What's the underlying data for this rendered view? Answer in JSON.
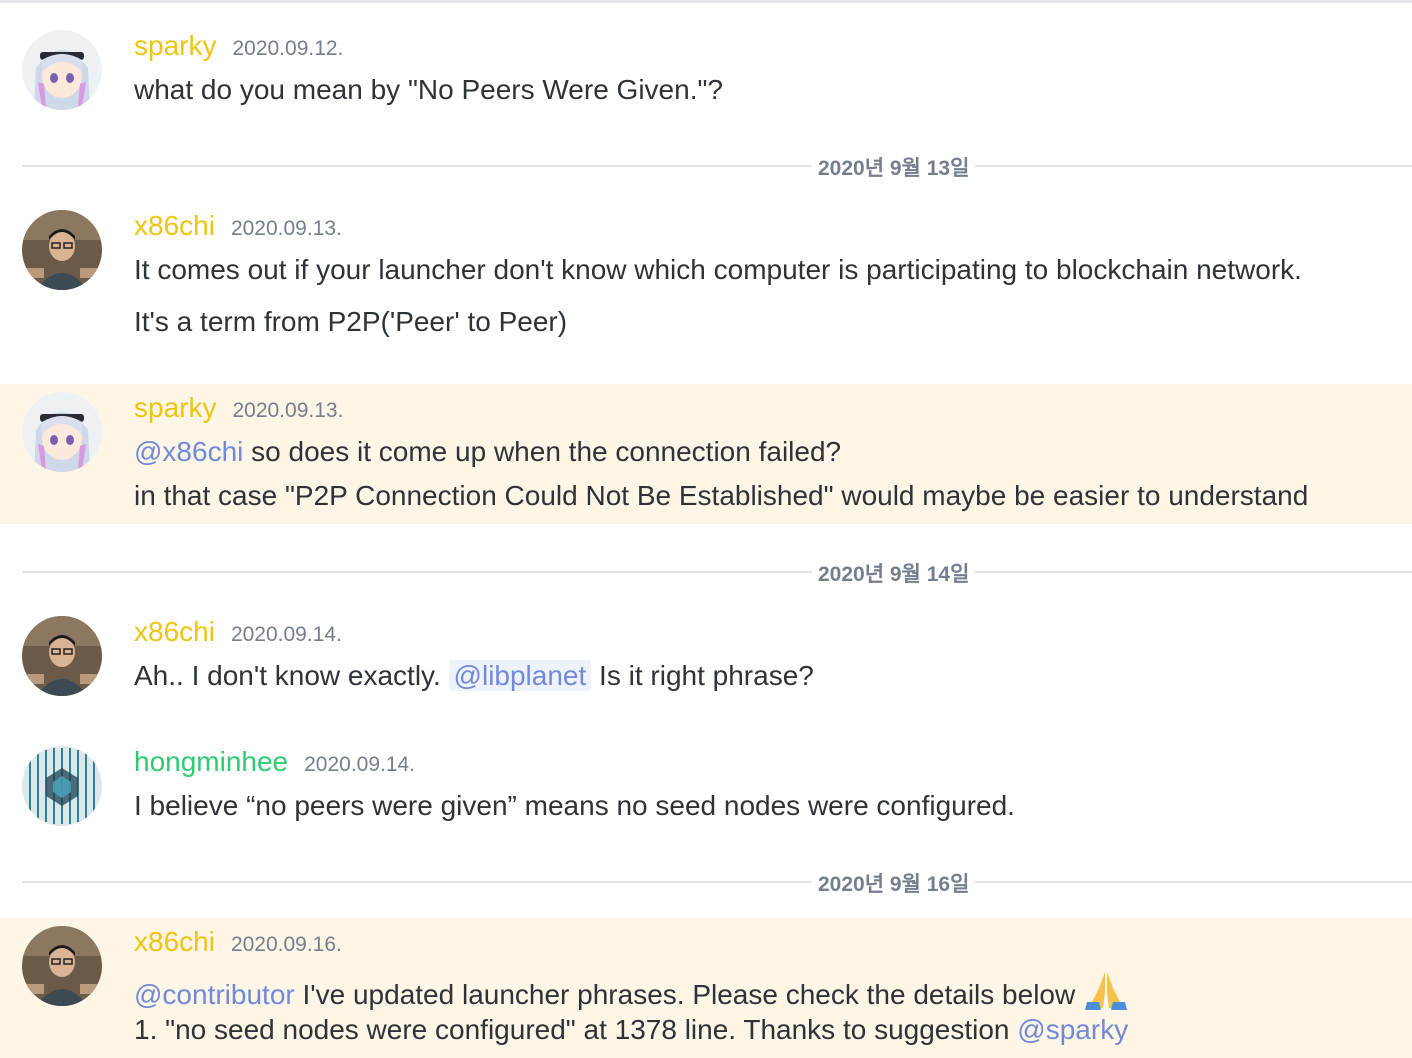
{
  "colors": {
    "username_yellow": "#f1c40f",
    "username_green": "#2ecc71",
    "mention_highlight": "#fdf5e6",
    "ping_blue": "#7289da",
    "timestamp_gray": "#747f8d"
  },
  "messages": [
    {
      "username": "sparky",
      "timestamp": "2020.09.12.",
      "lines": [
        "what do you mean by \"No Peers Were Given.\"?"
      ]
    },
    {
      "username": "x86chi",
      "timestamp": "2020.09.13.",
      "lines": [
        "It comes out if your launcher don't know which computer is participating to blockchain network.",
        "It's a term from P2P('Peer' to Peer)"
      ]
    },
    {
      "username": "sparky",
      "timestamp": "2020.09.13.",
      "mention": "@x86chi",
      "line1_rest": " so does it come up when the connection failed?",
      "line2": "in that case \"P2P Connection Could Not Be Established\" would maybe be easier to understand"
    },
    {
      "username": "x86chi",
      "timestamp": "2020.09.14.",
      "line_before": "Ah.. I don't know exactly. ",
      "role_mention": "@libplanet",
      "line_after": " Is it right phrase?"
    },
    {
      "username": "hongminhee",
      "timestamp": "2020.09.14.",
      "lines": [
        "I believe “no peers were given” means no seed nodes were configured."
      ]
    },
    {
      "username": "x86chi",
      "timestamp": "2020.09.16.",
      "mention": "@contributor",
      "line1_rest": " I've updated launcher phrases. Please check the details below ",
      "emoji": "folded-hands-emoji",
      "line2_text": "1. \"no seed nodes were configured\" at 1378 line. Thanks to suggestion ",
      "line2_mention": "@sparky"
    }
  ],
  "dividers": [
    "2020년 9월 13일",
    "2020년 9월 14일",
    "2020년 9월 16일"
  ]
}
